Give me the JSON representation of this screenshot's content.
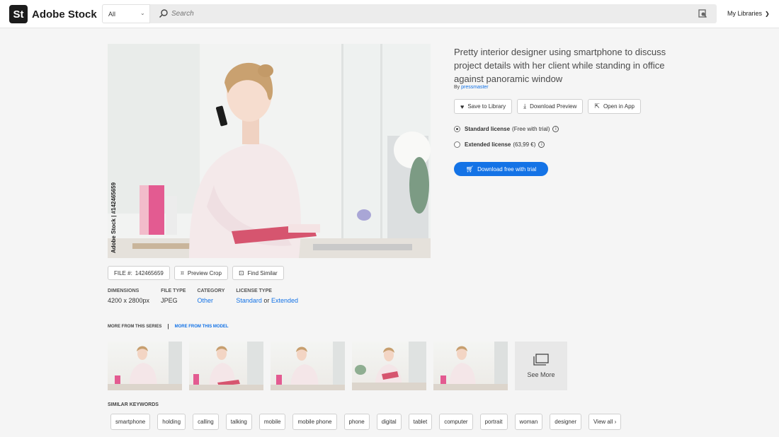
{
  "header": {
    "logo_badge": "St",
    "logo_text": "Adobe Stock",
    "scope_value": "All",
    "search_placeholder": "Search",
    "libraries_label": "My Libraries"
  },
  "asset": {
    "title": "Pretty interior designer using smartphone to discuss project details with her client while standing in office against panoramic window",
    "by_label": "By",
    "author": "pressmaster",
    "watermark": "Adobe Stock | #142465659",
    "actions": {
      "save": "Save to Library",
      "preview": "Download Preview",
      "open": "Open in App"
    },
    "licenses": [
      {
        "name": "Standard license",
        "note": "(Free with trial)",
        "selected": true
      },
      {
        "name": "Extended license",
        "note": "(63,99 €)",
        "selected": false
      }
    ],
    "cta": "Download free with trial",
    "file_label": "FILE #:",
    "file_id": "142465659",
    "preview_crop": "Preview Crop",
    "find_similar": "Find Similar",
    "specs": {
      "dimensions_label": "DIMENSIONS",
      "dimensions": "4200 x 2800px",
      "filetype_label": "FILE TYPE",
      "filetype": "JPEG",
      "category_label": "CATEGORY",
      "category": "Other",
      "license_label": "LICENSE TYPE",
      "license_standard": "Standard",
      "license_or": "or",
      "license_extended": "Extended"
    }
  },
  "series": {
    "series_tab": "MORE FROM THIS SERIES",
    "separator": "|",
    "model_tab": "MORE FROM THIS MODEL",
    "see_more": "See More"
  },
  "keywords": {
    "label": "SIMILAR KEYWORDS",
    "items": [
      "smartphone",
      "holding",
      "calling",
      "talking",
      "mobile",
      "mobile phone",
      "phone",
      "digital",
      "tablet",
      "computer",
      "portrait",
      "woman",
      "designer",
      "View all ›"
    ]
  },
  "colors": {
    "accent": "#1473e6",
    "brand": "#1c1c1c"
  }
}
